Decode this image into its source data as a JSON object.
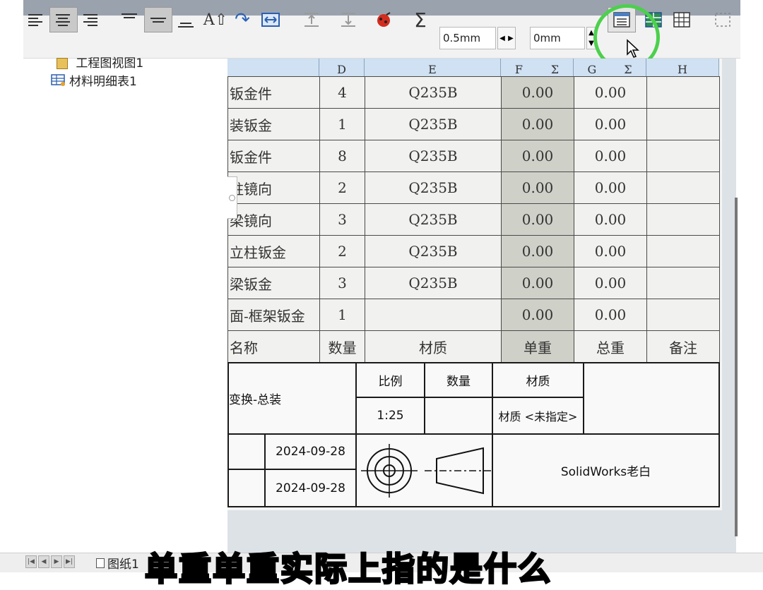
{
  "toolbar": {
    "line_width": "0.5mm",
    "offset": "0mm",
    "sigma": "Σ"
  },
  "tree": {
    "item1": "工程图视图1",
    "item2": "材料明细表1"
  },
  "bom": {
    "columns": [
      "D",
      "E",
      "F",
      "G",
      "H"
    ],
    "sigma": "Σ",
    "rows": [
      {
        "name": "钣金件",
        "qty": "4",
        "material": "Q235B",
        "unit_weight": "0.00",
        "total_weight": "0.00",
        "note": ""
      },
      {
        "name": "装钣金",
        "qty": "1",
        "material": "Q235B",
        "unit_weight": "0.00",
        "total_weight": "0.00",
        "note": ""
      },
      {
        "name": "钣金件",
        "qty": "8",
        "material": "Q235B",
        "unit_weight": "0.00",
        "total_weight": "0.00",
        "note": ""
      },
      {
        "name": "柱镜向",
        "qty": "2",
        "material": "Q235B",
        "unit_weight": "0.00",
        "total_weight": "0.00",
        "note": ""
      },
      {
        "name": "梁镜向",
        "qty": "3",
        "material": "Q235B",
        "unit_weight": "0.00",
        "total_weight": "0.00",
        "note": ""
      },
      {
        "name": "立柱钣金",
        "qty": "2",
        "material": "Q235B",
        "unit_weight": "0.00",
        "total_weight": "0.00",
        "note": ""
      },
      {
        "name": "梁钣金",
        "qty": "3",
        "material": "Q235B",
        "unit_weight": "0.00",
        "total_weight": "0.00",
        "note": ""
      },
      {
        "name": "面-框架钣金",
        "qty": "1",
        "material": "",
        "unit_weight": "0.00",
        "total_weight": "0.00",
        "note": ""
      }
    ],
    "header": {
      "name": "名称",
      "qty": "数量",
      "material": "材质",
      "unit_weight": "单重",
      "total_weight": "总重",
      "note": "备注"
    }
  },
  "title_block": {
    "drawing_name": "变换-总装",
    "scale_label": "比例",
    "scale_value": "1:25",
    "qty_label": "数量",
    "material_label": "材质",
    "material_value": "材质 <未指定>",
    "date1": "2024-09-28",
    "date2": "2024-09-28",
    "company": "SolidWorks老白"
  },
  "sheet_tab": "图纸1",
  "caption": "单重单重实际上指的是什么"
}
